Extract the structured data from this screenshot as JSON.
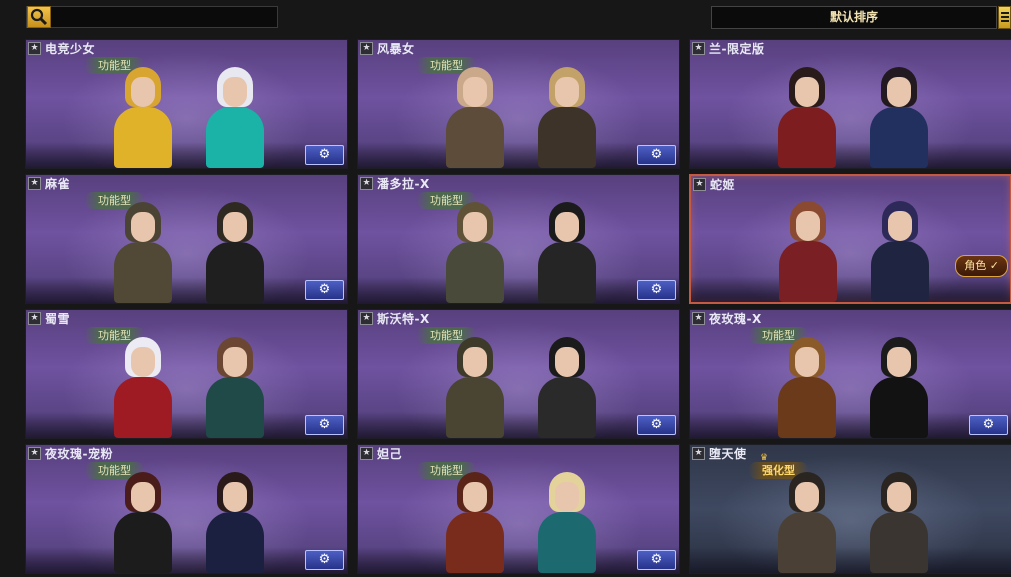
{
  "search": {
    "placeholder": ""
  },
  "sort": {
    "label": "默认排序"
  },
  "cards": [
    {
      "name": "电竞少女",
      "type": "功能型",
      "gear": true
    },
    {
      "name": "风暴女",
      "type": "功能型",
      "gear": true
    },
    {
      "name": "兰-限定版",
      "type": "",
      "gear": false
    },
    {
      "name": "麻雀",
      "type": "功能型",
      "gear": true
    },
    {
      "name": "潘多拉-X",
      "type": "功能型",
      "gear": true
    },
    {
      "name": "蛇姬",
      "type": "",
      "gear": false,
      "selected": true,
      "role_label": "角色 ✓"
    },
    {
      "name": "蜀雪",
      "type": "功能型",
      "gear": true
    },
    {
      "name": "斯沃特-X",
      "type": "功能型",
      "gear": true
    },
    {
      "name": "夜玫瑰-X",
      "type": "功能型",
      "gear": true
    },
    {
      "name": "夜玫瑰-宠粉",
      "type": "功能型",
      "gear": true
    },
    {
      "name": "妲己",
      "type": "功能型",
      "gear": true
    },
    {
      "name": "堕天使",
      "type": "强化型",
      "gear": false
    }
  ],
  "colors": {
    "card_purple": "#6f52a0",
    "selected_border": "#c45a43",
    "gear_button": "#3d4bb0",
    "sort_text": "#f2e3b0"
  },
  "icons": {
    "search": "magnifier-icon",
    "menu": "list-menu-icon",
    "favorite": "star-icon",
    "gear": "wrench-gear-icon"
  }
}
